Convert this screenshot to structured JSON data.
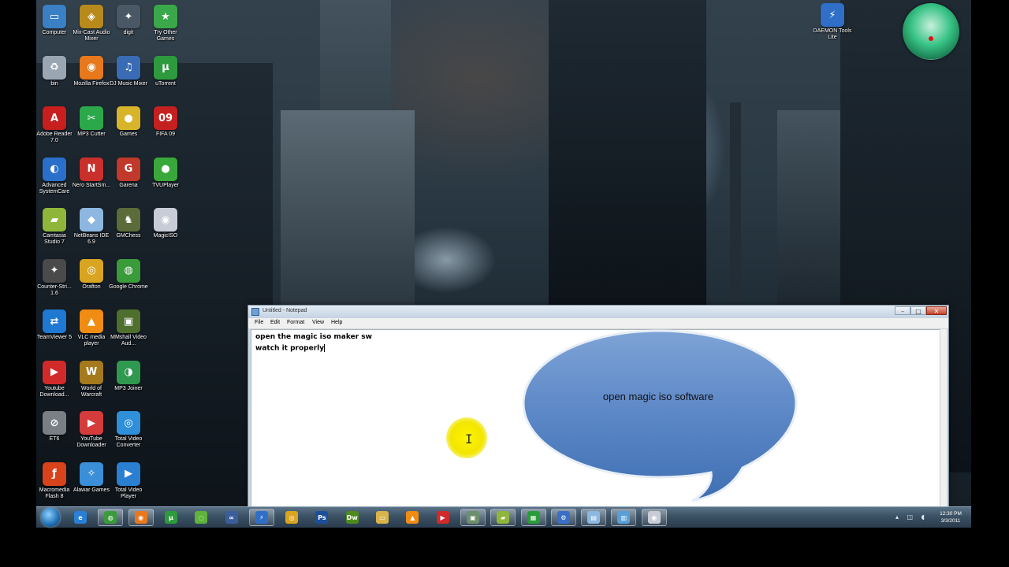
{
  "desktop": {
    "icons_col1": [
      {
        "label": "Computer",
        "icon": "computer-icon",
        "color": "#3b7fc4",
        "glyph": "▭"
      },
      {
        "label": "bin",
        "icon": "recycle-bin-icon",
        "color": "#9aa7b3",
        "glyph": "♻"
      },
      {
        "label": "Adobe Reader 7.0",
        "icon": "adobe-reader-icon",
        "color": "#c81e1e",
        "glyph": "A"
      },
      {
        "label": "Advanced SystemCare",
        "icon": "advanced-systemcare-icon",
        "color": "#2a6fc9",
        "glyph": "◐"
      },
      {
        "label": "Camtasia Studio 7",
        "icon": "camtasia-icon",
        "color": "#8fb63a",
        "glyph": "▰"
      },
      {
        "label": "Counter-Stri... 1.6",
        "icon": "counter-strike-icon",
        "color": "#4a4a4a",
        "glyph": "✦"
      },
      {
        "label": "TeamViewer 5",
        "icon": "teamviewer-icon",
        "color": "#1f78d1",
        "glyph": "⇄"
      },
      {
        "label": "Youtube Download...",
        "icon": "youtube-downloader-icon",
        "color": "#d12a2a",
        "glyph": "▶"
      },
      {
        "label": "ET6",
        "icon": "et6-icon",
        "color": "#7a7f86",
        "glyph": "⊘"
      },
      {
        "label": "Macromedia Flash 8",
        "icon": "flash-icon",
        "color": "#d8431c",
        "glyph": "ƒ"
      }
    ],
    "icons_col2": [
      {
        "label": "Mix-Cast Audio Mixer",
        "icon": "audio-mixer-icon",
        "color": "#b88a1c",
        "glyph": "◈"
      },
      {
        "label": "Mozilla Firefox",
        "icon": "firefox-icon",
        "color": "#e7781c",
        "glyph": "◉"
      },
      {
        "label": "MP3 Cutter",
        "icon": "mp3-cutter-icon",
        "color": "#2ba84a",
        "glyph": "✂"
      },
      {
        "label": "Nero StartSm...",
        "icon": "nero-icon",
        "color": "#c9302c",
        "glyph": "N"
      },
      {
        "label": "NetBeans IDE 6.9",
        "icon": "netbeans-icon",
        "color": "#8db7e0",
        "glyph": "◆"
      },
      {
        "label": "Orafton",
        "icon": "orafton-icon",
        "color": "#d9a520",
        "glyph": "◎"
      },
      {
        "label": "VLC media player",
        "icon": "vlc-icon",
        "color": "#f08c12",
        "glyph": "▲"
      },
      {
        "label": "World of Warcraft",
        "icon": "world-of-warcraft-icon",
        "color": "#a47a1c",
        "glyph": "W"
      },
      {
        "label": "YouTube Downloader",
        "icon": "youtube-icon",
        "color": "#d43c3c",
        "glyph": "▶"
      },
      {
        "label": "Alawar Games",
        "icon": "alawar-games-icon",
        "color": "#3a8fd8",
        "glyph": "✧"
      }
    ],
    "icons_col3": [
      {
        "label": "digit",
        "icon": "digit-icon",
        "color": "#4a5866",
        "glyph": "✦"
      },
      {
        "label": "DJ Music Mixer",
        "icon": "dj-music-mixer-icon",
        "color": "#3a6bb5",
        "glyph": "♫"
      },
      {
        "label": "Games",
        "icon": "games-icon",
        "color": "#d8b42a",
        "glyph": "●"
      },
      {
        "label": "Garena",
        "icon": "garena-icon",
        "color": "#c0392b",
        "glyph": "G"
      },
      {
        "label": "GMChess",
        "icon": "gmchess-icon",
        "color": "#5c6b3a",
        "glyph": "♞"
      },
      {
        "label": "Google Chrome",
        "icon": "chrome-icon",
        "color": "#3a9b3a",
        "glyph": "◍"
      },
      {
        "label": "MMshall Video Aud...",
        "icon": "video-audio-icon",
        "color": "#4f6f2f",
        "glyph": "▣"
      },
      {
        "label": "MP3 Joiner",
        "icon": "mp3-joiner-icon",
        "color": "#2f9a4f",
        "glyph": "◑"
      },
      {
        "label": "Total Video Converter",
        "icon": "total-video-converter-icon",
        "color": "#2f8fd8",
        "glyph": "◎"
      },
      {
        "label": "Total Video Player",
        "icon": "total-video-player-icon",
        "color": "#2a7fd0",
        "glyph": "▶"
      }
    ],
    "icons_col4": [
      {
        "label": "Try Other Games",
        "icon": "try-other-games-icon",
        "color": "#3aa84a",
        "glyph": "★"
      },
      {
        "label": "uTorrent",
        "icon": "utorrent-icon",
        "color": "#2e9a3e",
        "glyph": "µ"
      },
      {
        "label": "FIFA 09",
        "icon": "fifa-icon",
        "color": "#c52020",
        "glyph": "09"
      },
      {
        "label": "TVUPlayer",
        "icon": "tvuplayer-icon",
        "color": "#39a83a",
        "glyph": "●"
      },
      {
        "label": "MagicISO",
        "icon": "magiciso-icon",
        "color": "#c8ccd6",
        "glyph": "◉"
      }
    ],
    "right_icon": {
      "label": "DAEMON Tools Lite",
      "icon": "daemon-tools-icon",
      "color": "#2f6fc8",
      "glyph": "⚡"
    }
  },
  "notepad": {
    "title": "Untitled - Notepad",
    "menu": [
      "File",
      "Edit",
      "Format",
      "View",
      "Help"
    ],
    "lines": [
      "open the magic iso maker sw",
      "watch it properly"
    ],
    "minimize": "–",
    "maximize": "□",
    "close": "✕"
  },
  "callout": {
    "text": "open magic iso software"
  },
  "taskbar": {
    "items": [
      {
        "icon": "internet-explorer-icon",
        "color": "#2a7fd6",
        "glyph": "e",
        "active": false
      },
      {
        "icon": "chrome-icon",
        "color": "#3a9b3a",
        "glyph": "◍",
        "active": true
      },
      {
        "icon": "firefox-icon",
        "color": "#e7781c",
        "glyph": "◉",
        "active": true
      },
      {
        "icon": "utorrent-icon",
        "color": "#2e9a3e",
        "glyph": "µ",
        "active": false
      },
      {
        "icon": "xbox-icon",
        "color": "#5fb33c",
        "glyph": "◌",
        "active": false
      },
      {
        "icon": "dj-mixer-icon",
        "color": "#3a5d9b",
        "glyph": "∞",
        "active": false
      },
      {
        "icon": "daemon-tools-icon",
        "color": "#2f6fc8",
        "glyph": "⚡",
        "active": true
      },
      {
        "icon": "orafton-icon",
        "color": "#d9a520",
        "glyph": "◎",
        "active": false
      },
      {
        "icon": "photoshop-icon",
        "color": "#1c4f9b",
        "glyph": "Ps",
        "active": false
      },
      {
        "icon": "dreamweaver-icon",
        "color": "#4f8a1c",
        "glyph": "Dw",
        "active": false
      },
      {
        "icon": "folder-icon",
        "color": "#d9b44a",
        "glyph": "▭",
        "active": false
      },
      {
        "icon": "vlc-icon",
        "color": "#f08c12",
        "glyph": "▲",
        "active": false
      },
      {
        "icon": "youtube-downloader-icon",
        "color": "#d12a2a",
        "glyph": "▶",
        "active": false
      },
      {
        "icon": "screen-recorder-icon",
        "color": "#6c8f6c",
        "glyph": "▣",
        "active": true
      },
      {
        "icon": "camtasia-icon",
        "color": "#8fb63a",
        "glyph": "▰",
        "active": true
      },
      {
        "icon": "media-icon",
        "color": "#2a9b3a",
        "glyph": "▦",
        "active": true
      },
      {
        "icon": "network-icon",
        "color": "#3a6fc8",
        "glyph": "⚙",
        "active": true
      },
      {
        "icon": "notepad-icon",
        "color": "#8bb8e0",
        "glyph": "▤",
        "active": true
      },
      {
        "icon": "display-icon",
        "color": "#5aa0d8",
        "glyph": "▥",
        "active": true
      },
      {
        "icon": "magiciso-icon",
        "color": "#c8ccd6",
        "glyph": "◉",
        "active": true
      }
    ],
    "clock_time": "12:30 PM",
    "clock_date": "3/3/2011",
    "tray": "▴ ◫ ◖"
  }
}
